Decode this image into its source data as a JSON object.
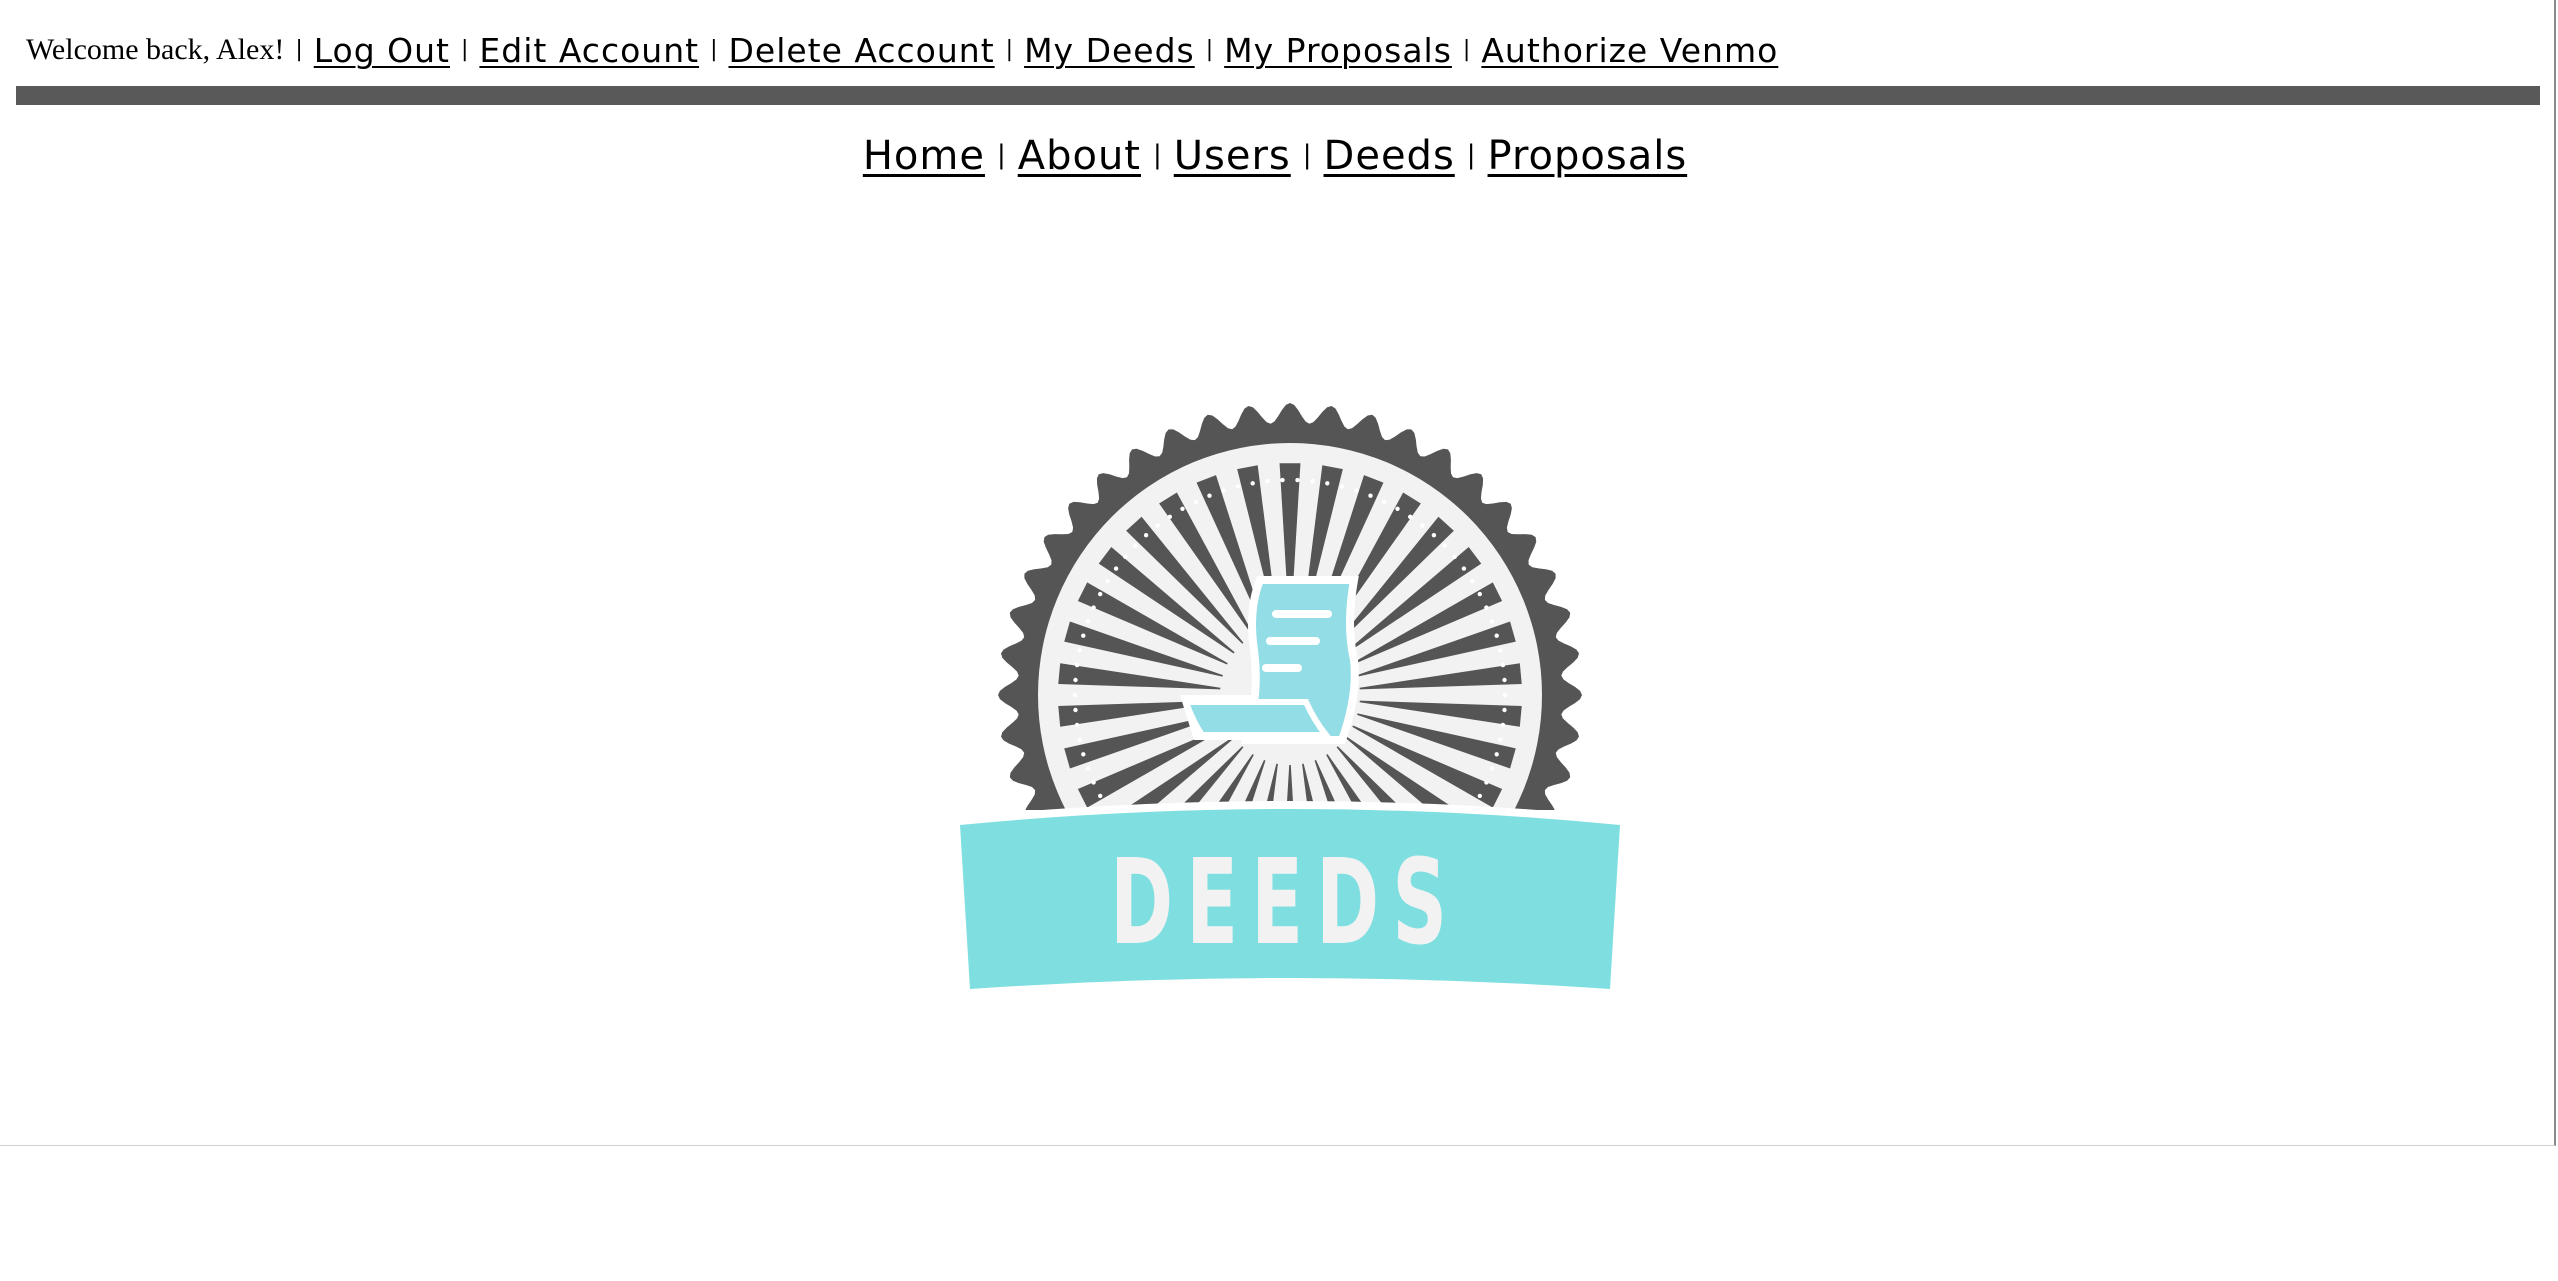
{
  "header": {
    "welcome_text": "Welcome back, Alex!",
    "separator": "|",
    "links": [
      {
        "label": "Log Out"
      },
      {
        "label": "Edit Account"
      },
      {
        "label": "Delete Account"
      },
      {
        "label": "My Deeds"
      },
      {
        "label": "My Proposals"
      },
      {
        "label": "Authorize Venmo"
      }
    ]
  },
  "nav": {
    "links": [
      {
        "label": "Home"
      },
      {
        "label": "About"
      },
      {
        "label": "Users"
      },
      {
        "label": "Deeds"
      },
      {
        "label": "Proposals"
      }
    ]
  },
  "logo": {
    "text": "DEEDS",
    "colors": {
      "dark": "#555555",
      "accent": "#7fdfe0",
      "paper": "#93dde6",
      "light": "#f2f2f2"
    }
  }
}
